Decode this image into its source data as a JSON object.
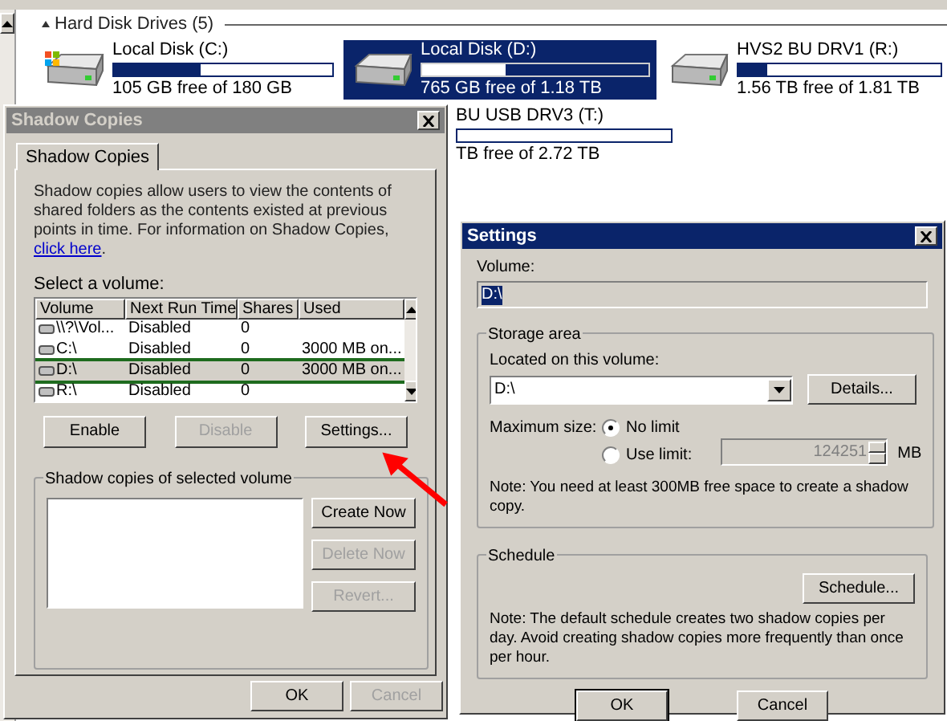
{
  "explorer": {
    "group_header": "Hard Disk Drives (5)",
    "drives": [
      {
        "kind": "system",
        "name": "Local Disk (C:)",
        "free": "105 GB free of 180 GB",
        "level": 0.4,
        "selected": false
      },
      {
        "kind": "disk",
        "name": "Local Disk (D:)",
        "free": "765 GB free of 1.18 TB",
        "level": 0.37,
        "selected": true
      },
      {
        "kind": "disk",
        "name": "HVS2 BU DRV1 (R:)",
        "free": "1.56 TB free of 1.81 TB",
        "level": 0.14,
        "selected": false
      }
    ],
    "partial_drive": {
      "name": "BU USB DRV3 (T:)",
      "free": "TB free of 2.72 TB"
    }
  },
  "shadow_dialog": {
    "title": "Shadow Copies",
    "active": false,
    "tabs": [
      {
        "label": "Shadow Copies",
        "selected": true
      }
    ],
    "description": "Shadow copies allow users to view the contents of shared folders as the contents existed at previous points in time. For information on Shadow Copies,",
    "link": "click here",
    "description_end": ".",
    "volume_label": "Select a volume:",
    "columns": [
      "Volume",
      "Next Run Time",
      "Shares",
      "Used"
    ],
    "rows": [
      {
        "volume": "\\\\?\\Vol...",
        "next_run": "Disabled",
        "shares": "0",
        "selected": false,
        "outlined": false
      },
      {
        "volume": "C:\\",
        "next_run": "Disabled",
        "shares": "0",
        "used": "3000 MB on...",
        "selected": false,
        "outlined": false
      },
      {
        "volume": "D:\\",
        "next_run": "Disabled",
        "shares": "0",
        "used": "3000 MB on...",
        "selected": true,
        "outlined": true
      },
      {
        "volume": "R:\\",
        "next_run": "Disabled",
        "shares": "0",
        "selected": false,
        "outlined": false
      }
    ],
    "volume_buttons": [
      {
        "label": "Enable",
        "disabled": false
      },
      {
        "label": "Disable",
        "disabled": true
      },
      {
        "label": "Settings...",
        "disabled": false
      }
    ],
    "copies_group": "Shadow copies of selected volume",
    "copies_buttons": [
      {
        "label": "Create Now",
        "disabled": false
      },
      {
        "label": "Delete Now",
        "disabled": true
      },
      {
        "label": "Revert...",
        "disabled": true
      }
    ],
    "buttons": [
      {
        "label": "OK",
        "disabled": false
      },
      {
        "label": "Cancel",
        "disabled": true
      }
    ]
  },
  "settings_dialog": {
    "title": "Settings",
    "active": true,
    "volume_label": "Volume:",
    "volume_value": "D:\\",
    "storage_group": "Storage area",
    "located_label": "Located on this volume:",
    "located_value": "D:\\",
    "details_button": "Details...",
    "max_size_label": "Maximum size:",
    "options": [
      {
        "label": "No limit",
        "selected": true
      },
      {
        "label": "Use limit:",
        "selected": false
      }
    ],
    "limit_value": "124251",
    "limit_unit": "MB",
    "storage_note": "Note: You need at least 300MB free space to create a shadow copy.",
    "schedule_group": "Schedule",
    "schedule_button": "Schedule...",
    "schedule_note": "Note: The default schedule creates two shadow copies per day. Avoid creating shadow copies more frequently than once per hour.",
    "buttons": [
      {
        "label": "OK",
        "default": true
      },
      {
        "label": "Cancel",
        "default": false
      }
    ]
  }
}
